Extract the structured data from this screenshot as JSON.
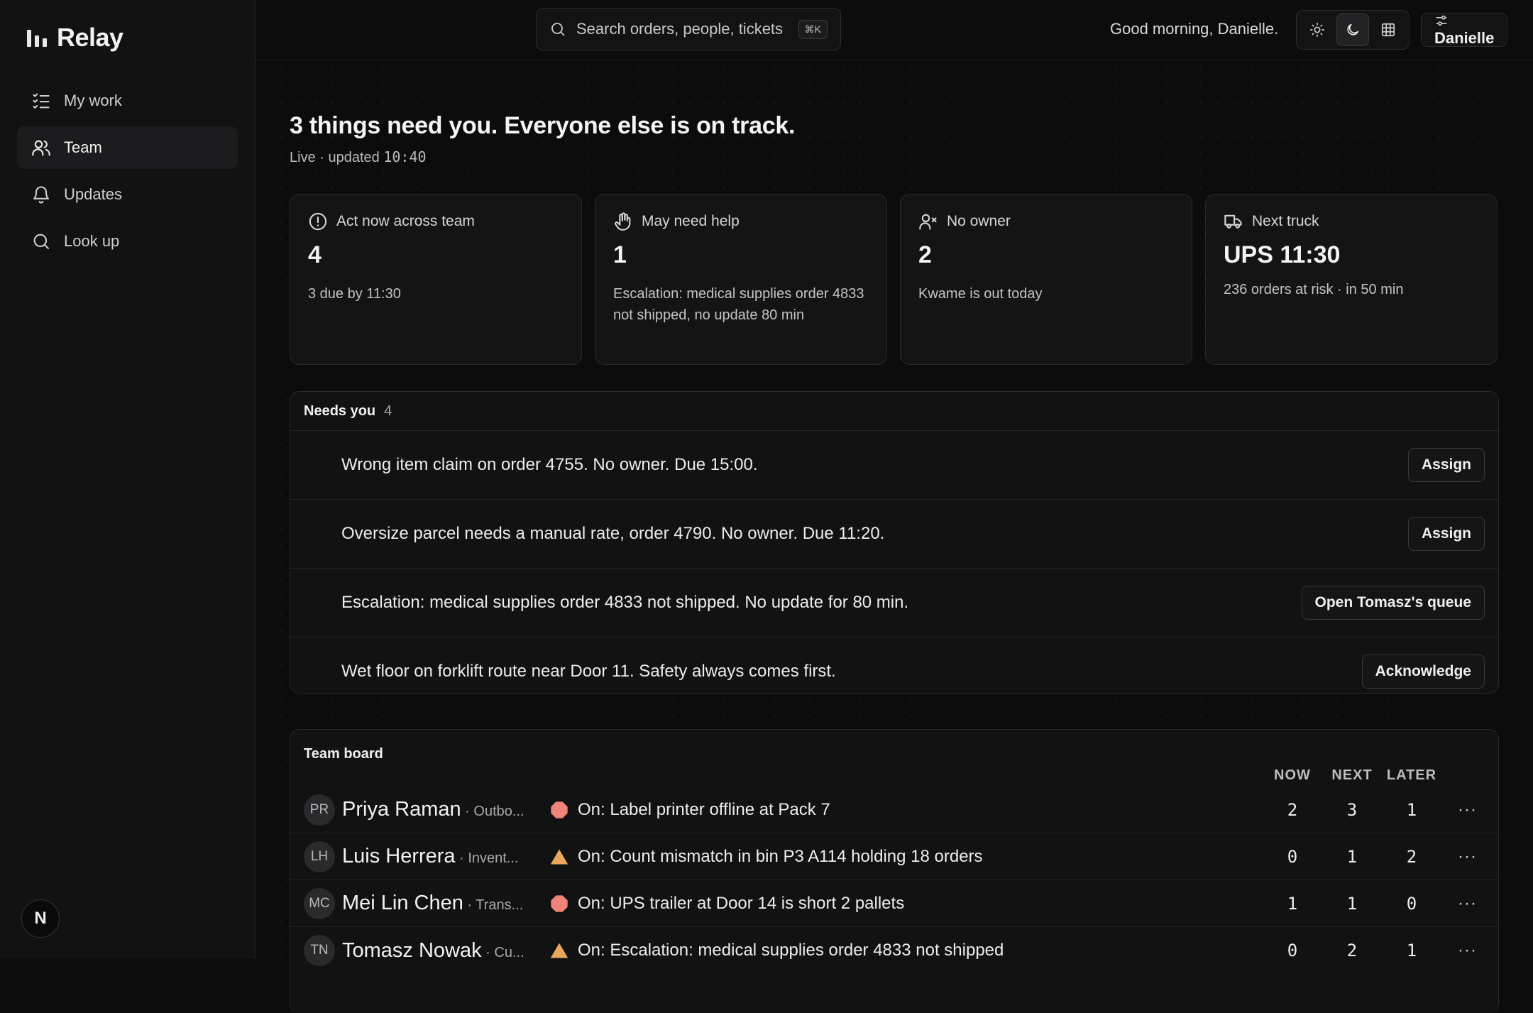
{
  "brand": {
    "name": "Relay"
  },
  "nav": [
    {
      "label": "My work",
      "icon": "list-check-icon"
    },
    {
      "label": "Team",
      "icon": "users-icon",
      "active": true
    },
    {
      "label": "Updates",
      "icon": "bell-icon"
    },
    {
      "label": "Look up",
      "icon": "search-icon"
    }
  ],
  "footer_badge": "N",
  "search": {
    "placeholder": "Search orders, people, tickets",
    "shortcut": "⌘K"
  },
  "greeting": "Good morning, Danielle.",
  "user": {
    "name": "Danielle"
  },
  "headline": "3 things need you. Everyone else is on track.",
  "status": {
    "prefix": "Live · updated ",
    "time": "10:40"
  },
  "cards": [
    {
      "label": "Act now across team",
      "icon": "alert-circle-icon",
      "value": "4",
      "detail": "3 due by 11:30"
    },
    {
      "label": "May need help",
      "icon": "hand-icon",
      "value": "1",
      "detail": "Escalation: medical supplies order 4833 not shipped, no update 80 min"
    },
    {
      "label": "No owner",
      "icon": "user-x-icon",
      "value": "2",
      "detail": "Kwame is out today"
    },
    {
      "label": "Next truck",
      "icon": "truck-icon",
      "value": "UPS 11:30",
      "detail": "236 orders at risk · in 50 min"
    }
  ],
  "needs_you": {
    "title": "Needs you",
    "count": "4",
    "items": [
      {
        "text": "Wrong item claim on order 4755. No owner. Due 15:00.",
        "action": "Assign"
      },
      {
        "text": "Oversize parcel needs a manual rate, order 4790. No owner. Due 11:20.",
        "action": "Assign"
      },
      {
        "text": "Escalation: medical supplies order 4833 not shipped. No update for 80 min.",
        "action": "Open Tomasz's queue"
      },
      {
        "text": "Wet floor on forklift route near Door 11. Safety always comes first.",
        "action": "Acknowledge"
      }
    ]
  },
  "team_board": {
    "title": "Team board",
    "columns": [
      "NOW",
      "NEXT",
      "LATER"
    ],
    "more_label": "···",
    "rows": [
      {
        "initials": "PR",
        "name": "Priya Raman",
        "role": " · Outbo...",
        "status_icon": "octagon-icon",
        "status_color": "#f0837a",
        "status": "On: Label printer offline at Pack 7",
        "now": "2",
        "next": "3",
        "later": "1"
      },
      {
        "initials": "LH",
        "name": "Luis Herrera",
        "role": " · Invent...",
        "status_icon": "triangle-icon",
        "status_color": "#e8a85c",
        "status": "On: Count mismatch in bin P3 A114 holding 18 orders",
        "now": "0",
        "next": "1",
        "later": "2"
      },
      {
        "initials": "MC",
        "name": "Mei Lin Chen",
        "role": " · Trans...",
        "status_icon": "octagon-icon",
        "status_color": "#f0837a",
        "status": "On: UPS trailer at Door 14 is short 2 pallets",
        "now": "1",
        "next": "1",
        "later": "0"
      },
      {
        "initials": "TN",
        "name": "Tomasz Nowak",
        "role": " · Cu...",
        "status_icon": "triangle-icon",
        "status_color": "#e8a85c",
        "status": "On: Escalation: medical supplies order 4833 not shipped",
        "now": "0",
        "next": "2",
        "later": "1"
      }
    ]
  }
}
